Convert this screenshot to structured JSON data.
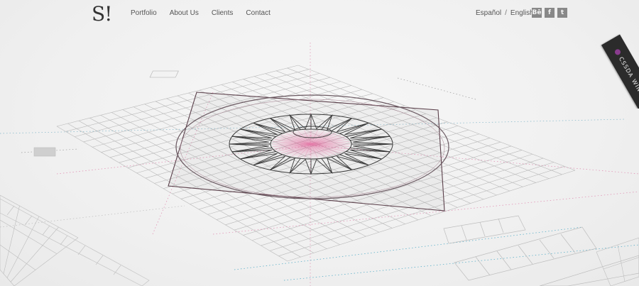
{
  "brand": {
    "logo_text": "S!"
  },
  "nav": {
    "items": [
      {
        "label": "Portfolio"
      },
      {
        "label": "About Us"
      },
      {
        "label": "Clients"
      },
      {
        "label": "Contact"
      }
    ]
  },
  "language": {
    "spanish": "Español",
    "separator": "/",
    "english": "English"
  },
  "social": {
    "behance": "Bē",
    "facebook": "f",
    "twitter": "t"
  },
  "award": {
    "site": "CSSDA",
    "status": "WINNER",
    "accent_color": "#8a3c8f",
    "ribbon_color": "#2b2b2b"
  },
  "hero": {
    "grid_color": "#bdbdbd",
    "accent_pink": "#e04b8c",
    "accent_cyan": "#4aa8c4"
  }
}
